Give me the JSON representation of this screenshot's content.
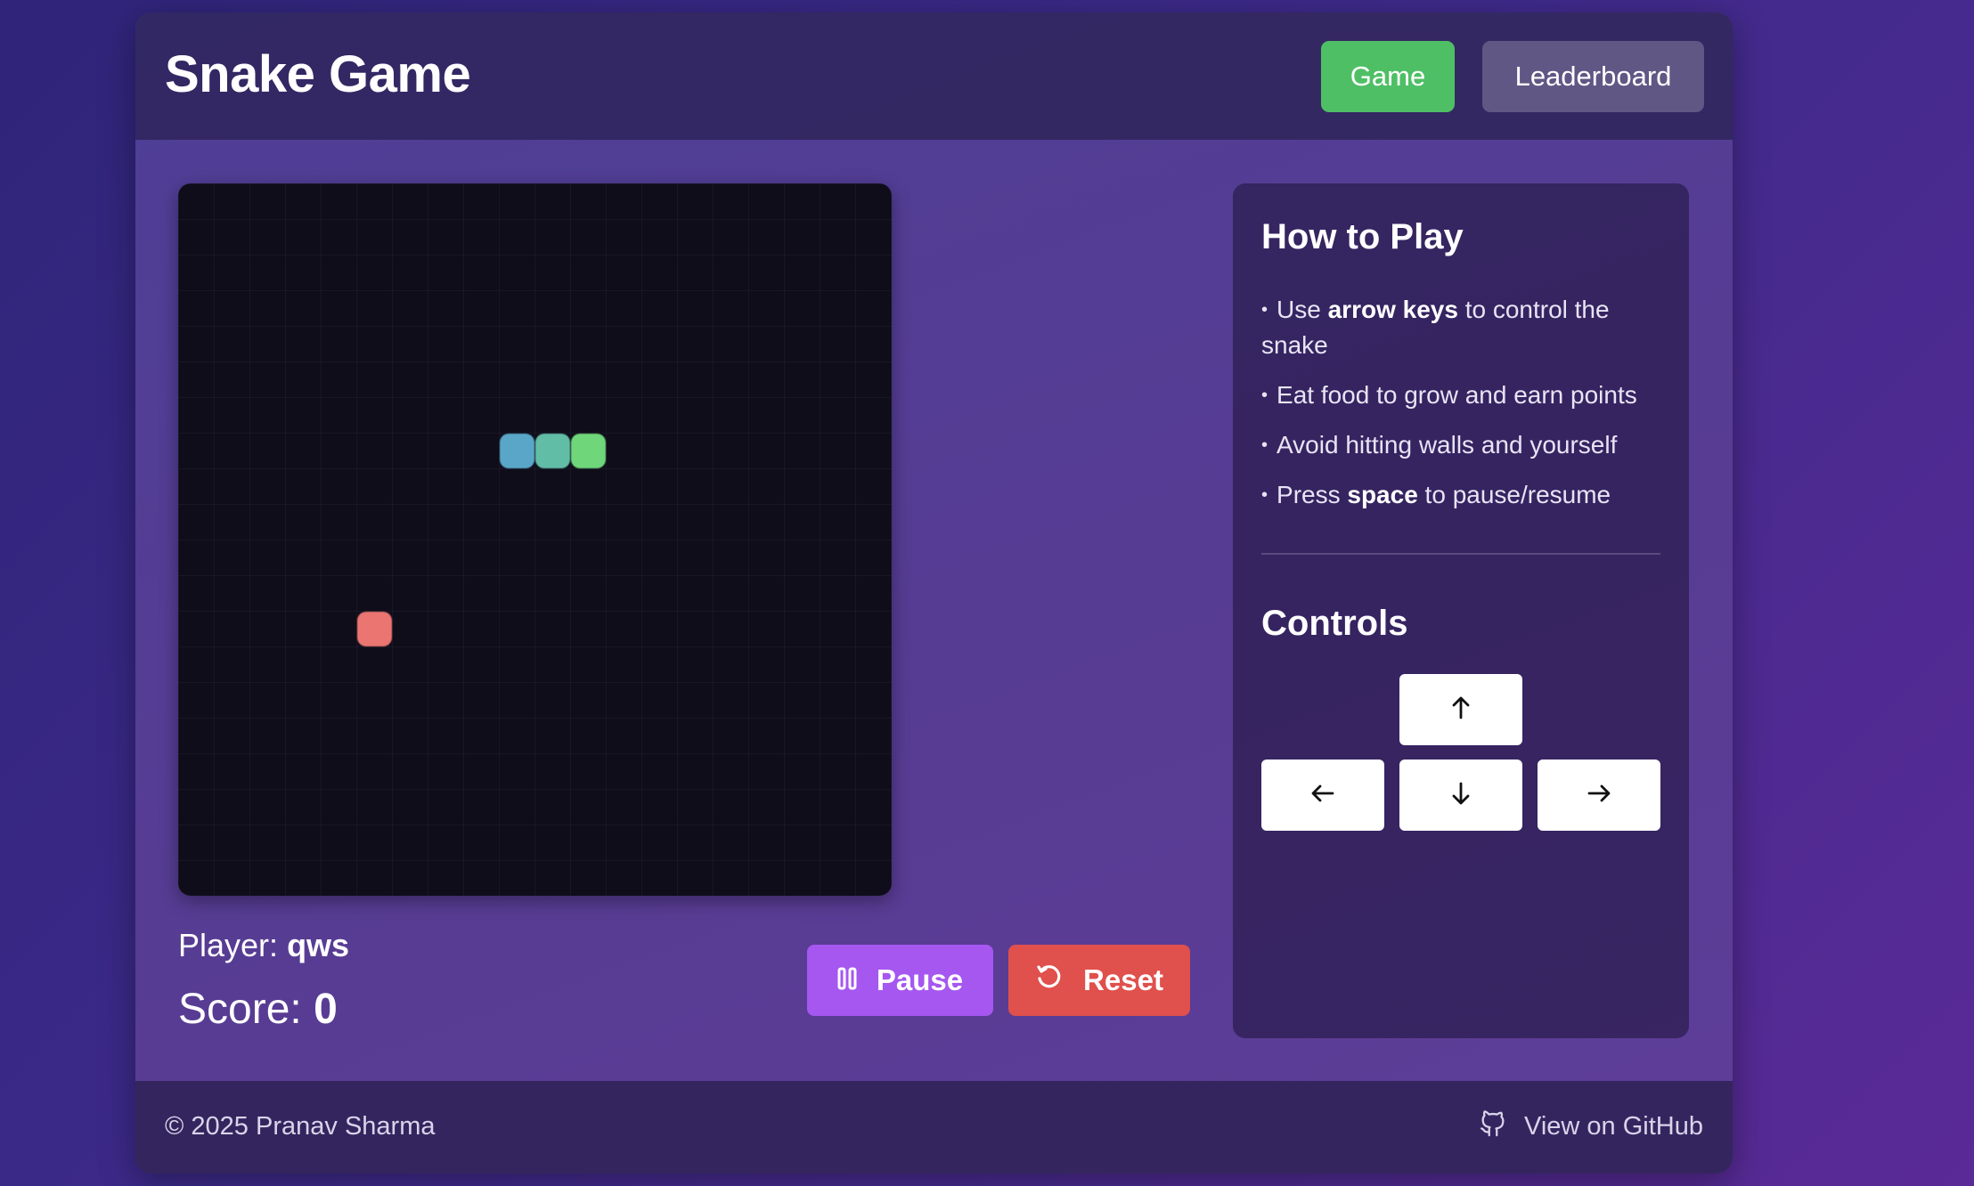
{
  "header": {
    "title": "Snake Game",
    "nav": {
      "game_label": "Game",
      "leaderboard_label": "Leaderboard"
    }
  },
  "board": {
    "grid_size": 20,
    "snake": [
      {
        "col": 9,
        "row": 7,
        "color": "#5aa6c8"
      },
      {
        "col": 10,
        "row": 7,
        "color": "#62bda6"
      },
      {
        "col": 11,
        "row": 7,
        "color": "#6fd67a"
      }
    ],
    "food": {
      "col": 5,
      "row": 12,
      "color": "#ea7571"
    }
  },
  "status": {
    "player_label": "Player:",
    "player_name": "qws",
    "score_label": "Score:",
    "score_value": "0"
  },
  "actions": {
    "pause_label": "Pause",
    "reset_label": "Reset"
  },
  "how_to_play": {
    "title": "How to Play",
    "rules": [
      {
        "pre": "Use ",
        "bold": "arrow keys",
        "post": " to control the snake"
      },
      {
        "pre": "Eat food to grow and earn points",
        "bold": "",
        "post": ""
      },
      {
        "pre": "Avoid hitting walls and yourself",
        "bold": "",
        "post": ""
      },
      {
        "pre": "Press ",
        "bold": "space",
        "post": " to pause/resume"
      }
    ]
  },
  "controls": {
    "title": "Controls",
    "keys": [
      "arrow-up-icon",
      "arrow-left-icon",
      "arrow-down-icon",
      "arrow-right-icon"
    ]
  },
  "footer": {
    "copyright": "© 2025 Pranav Sharma",
    "github_label": "View on GitHub",
    "github_icon": "github-icon"
  },
  "colors": {
    "nav_active": "#4fbf66",
    "pause_button": "#a557f0",
    "reset_button": "#e0504c"
  }
}
